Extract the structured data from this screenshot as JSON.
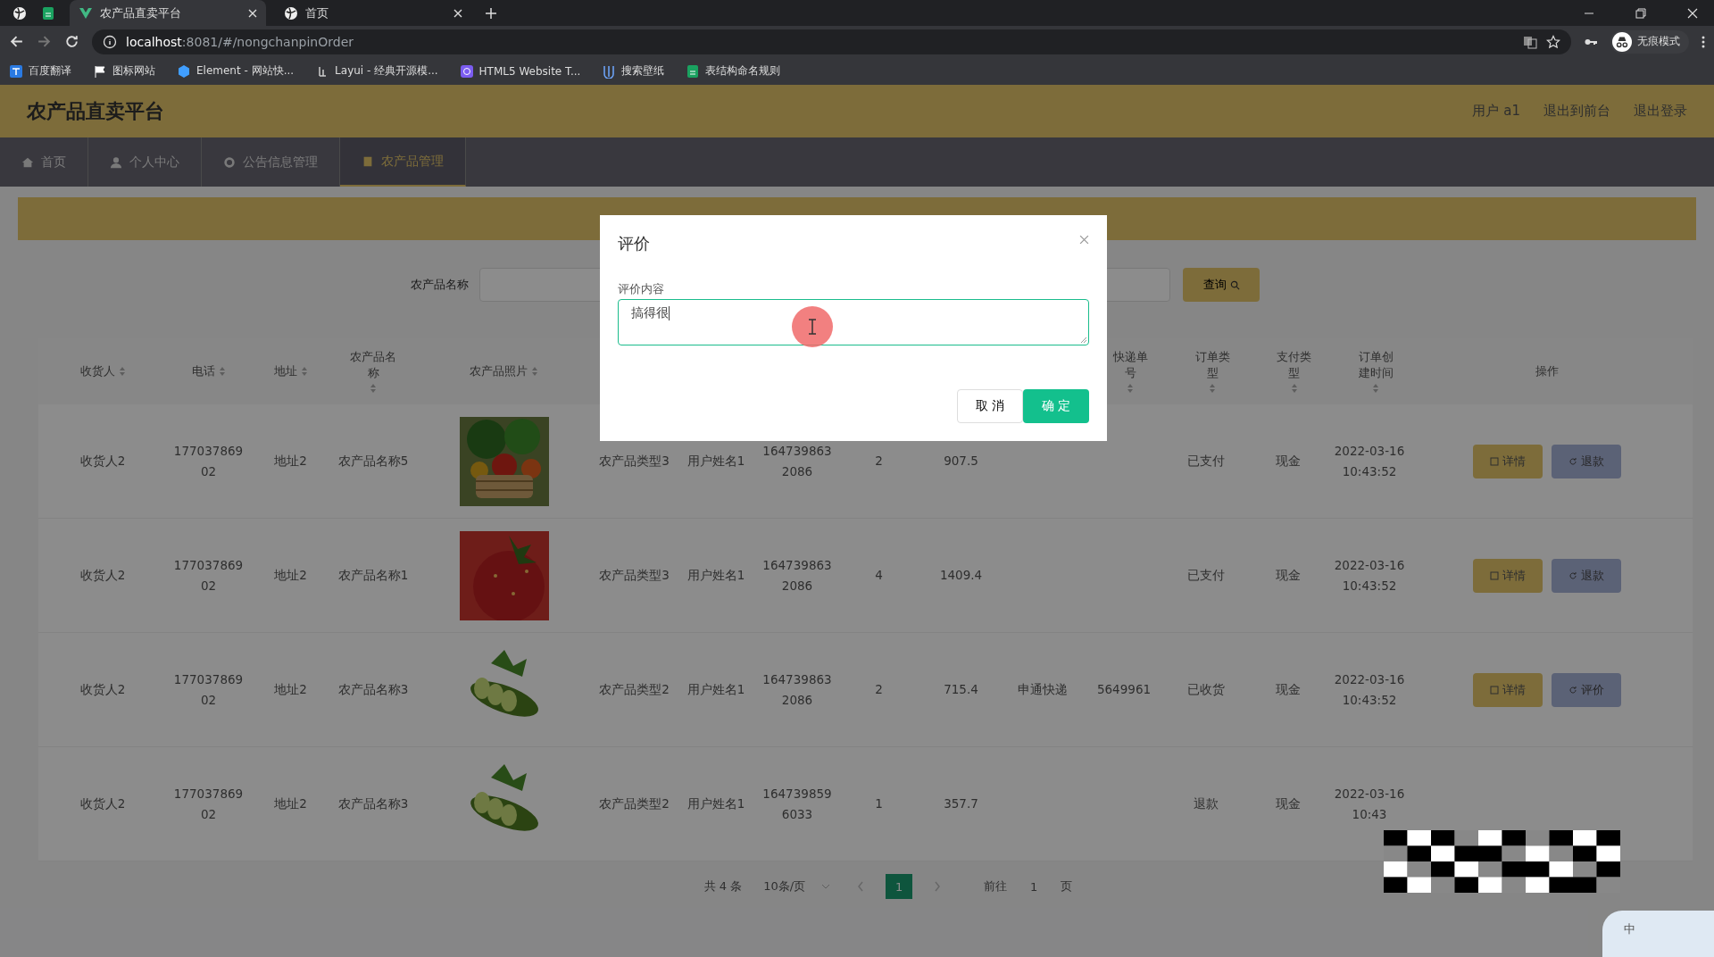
{
  "browser": {
    "tabs": [
      {
        "title": "农产品直卖平台",
        "selected": true
      },
      {
        "title": "首页",
        "selected": false
      }
    ],
    "url_host": "localhost",
    "url_path": ":8081/#/nongchanpinOrder",
    "incognito_label": "无痕模式",
    "bookmarks": [
      "百度翻译",
      "图标网站",
      "Element - 网站快...",
      "Layui - 经典开源模...",
      "HTML5 Website T...",
      "搜索壁纸",
      "表结构命名规则"
    ]
  },
  "app": {
    "title": "农产品直卖平台",
    "user_links": [
      "用户 a1",
      "退出到前台",
      "退出登录"
    ],
    "nav": [
      {
        "label": "首页",
        "selected": false
      },
      {
        "label": "个人中心",
        "selected": false
      },
      {
        "label": "公告信息管理",
        "selected": false
      },
      {
        "label": "农产品管理",
        "selected": true
      }
    ]
  },
  "search": {
    "label": "农产品名称",
    "button": "查询"
  },
  "table": {
    "columns_left": [
      "收货人",
      "电话",
      "地址",
      "农产品名称",
      "农产品照片"
    ],
    "columns_right": [
      "快递单号",
      "订单类型",
      "支付类型",
      "订单创建时间"
    ],
    "actions_column": "操作",
    "rows": [
      {
        "cells": [
          "收货人2",
          "17703786902",
          "地址2",
          "农产品名称5",
          {
            "kind": "picture"
          },
          "农产品类型3",
          "用户姓名1",
          "1647398632086",
          "2",
          "907.5",
          {
            "kind": "empty"
          },
          {
            "kind": "empty"
          },
          "已支付",
          "现金",
          "2022-03-16 10:43:52"
        ],
        "actions": [
          {
            "label": "详情",
            "kind": "detail"
          },
          {
            "label": "退款",
            "kind": "secondary"
          }
        ]
      },
      {
        "cells": [
          "收货人2",
          "17703786902",
          "地址2",
          "农产品名称1",
          {
            "kind": "picture"
          },
          "农产品类型3",
          "用户姓名1",
          "1647398632086",
          "4",
          "1409.4",
          {
            "kind": "empty"
          },
          {
            "kind": "empty"
          },
          "已支付",
          "现金",
          "2022-03-16 10:43:52"
        ],
        "actions": [
          {
            "label": "详情",
            "kind": "detail"
          },
          {
            "label": "退款",
            "kind": "secondary"
          }
        ]
      },
      {
        "cells": [
          "收货人2",
          "17703786902",
          "地址2",
          "农产品名称3",
          {
            "kind": "picture"
          },
          "农产品类型2",
          "用户姓名1",
          "1647398632086",
          "2",
          "715.4",
          "申通快递",
          "5649961",
          "已收货",
          "现金",
          "2022-03-16 10:43:52"
        ],
        "actions": [
          {
            "label": "详情",
            "kind": "detail"
          },
          {
            "label": "评价",
            "kind": "secondary"
          }
        ]
      },
      {
        "cells": [
          "收货人2",
          "17703786902",
          "地址2",
          "农产品名称3",
          {
            "kind": "picture"
          },
          "农产品类型2",
          "用户姓名1",
          "1647398596033",
          "1",
          "357.7",
          {
            "kind": "empty"
          },
          {
            "kind": "empty"
          },
          "退款",
          "现金",
          "2022-03-16 10:43"
        ]
      }
    ]
  },
  "pagination": {
    "total": "共 4 条",
    "page_size": "10条/页",
    "pages": [
      {
        "label": "1",
        "selected": true
      }
    ],
    "goto_label": "前往",
    "goto_value": "1",
    "page_suffix": "页"
  },
  "dialog": {
    "title": "评价",
    "field_label": "评价内容",
    "value": "搞得很",
    "cancel": "取 消",
    "confirm": "确 定"
  },
  "ime": {
    "label": "中"
  }
}
